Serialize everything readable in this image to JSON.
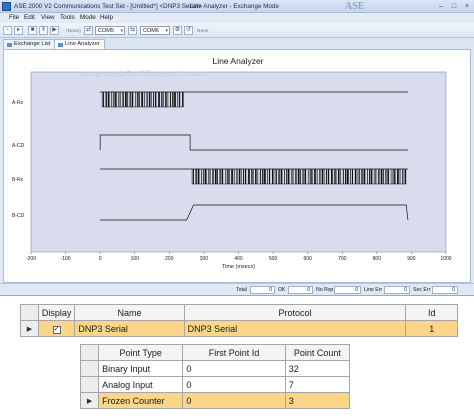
{
  "window": {
    "title": "ASE 2000 V2 Communications Test Set - [Untitled*] <DNP3 Serial>",
    "mode_title": "Line Analyzer - Exchange Mode",
    "brand": "ASE"
  },
  "menu": [
    "File",
    "Edit",
    "View",
    "Tools",
    "Mode",
    "Help"
  ],
  "toolbar": {
    "none_labels": [
      "(None)",
      "None"
    ],
    "com_ports": [
      "COM5",
      "COM6"
    ]
  },
  "tabs": [
    {
      "label": "Exchange List",
      "active": false
    },
    {
      "label": "Line Analyzer",
      "active": true
    }
  ],
  "watermark": "program-plc.blogspot.com",
  "chart_data": {
    "type": "line",
    "title": "Line Analyzer",
    "xlabel": "Time (msecs)",
    "xlim": [
      -200,
      1000
    ],
    "xticks": [
      "-200",
      "-100",
      "0",
      "100",
      "200",
      "300",
      "400",
      "500",
      "600",
      "700",
      "800",
      "900",
      "1000"
    ],
    "series": [
      {
        "name": "A-Rx",
        "kind": "data",
        "idle_from": 0,
        "idle_to": 890,
        "burst_from": 5,
        "burst_to": 240
      },
      {
        "name": "A-CD",
        "kind": "level",
        "steps": [
          [
            0,
            0
          ],
          [
            0,
            1
          ],
          [
            260,
            1
          ],
          [
            260,
            0
          ],
          [
            890,
            0
          ]
        ]
      },
      {
        "name": "B-Rx",
        "kind": "data",
        "idle_from": 0,
        "idle_to": 890,
        "burst_from": 265,
        "burst_to": 885
      },
      {
        "name": "B-CD",
        "kind": "level",
        "steps": [
          [
            0,
            0
          ],
          [
            250,
            0
          ],
          [
            270,
            1
          ],
          [
            885,
            1
          ],
          [
            890,
            0
          ]
        ]
      }
    ]
  },
  "statusbar": {
    "labels": [
      "Total",
      "OK",
      "No Rsp",
      "Line Err",
      "Sec Err"
    ],
    "values": [
      "0",
      "0",
      "0",
      "0",
      "0"
    ]
  },
  "device_grid": {
    "headers": [
      "Display",
      "Name",
      "Protocol",
      "Id"
    ],
    "rows": [
      {
        "display": "✓",
        "name": "DNP3 Serial",
        "protocol": "DNP3 Serial",
        "id": "1"
      }
    ]
  },
  "point_grid": {
    "headers": [
      "Point Type",
      "First Point Id",
      "Point Count"
    ],
    "rows": [
      {
        "type": "Binary Input",
        "first": "0",
        "count": "32"
      },
      {
        "type": "Analog Input",
        "first": "0",
        "count": "7"
      },
      {
        "type": "Frozen Counter",
        "first": "0",
        "count": "3"
      }
    ]
  }
}
